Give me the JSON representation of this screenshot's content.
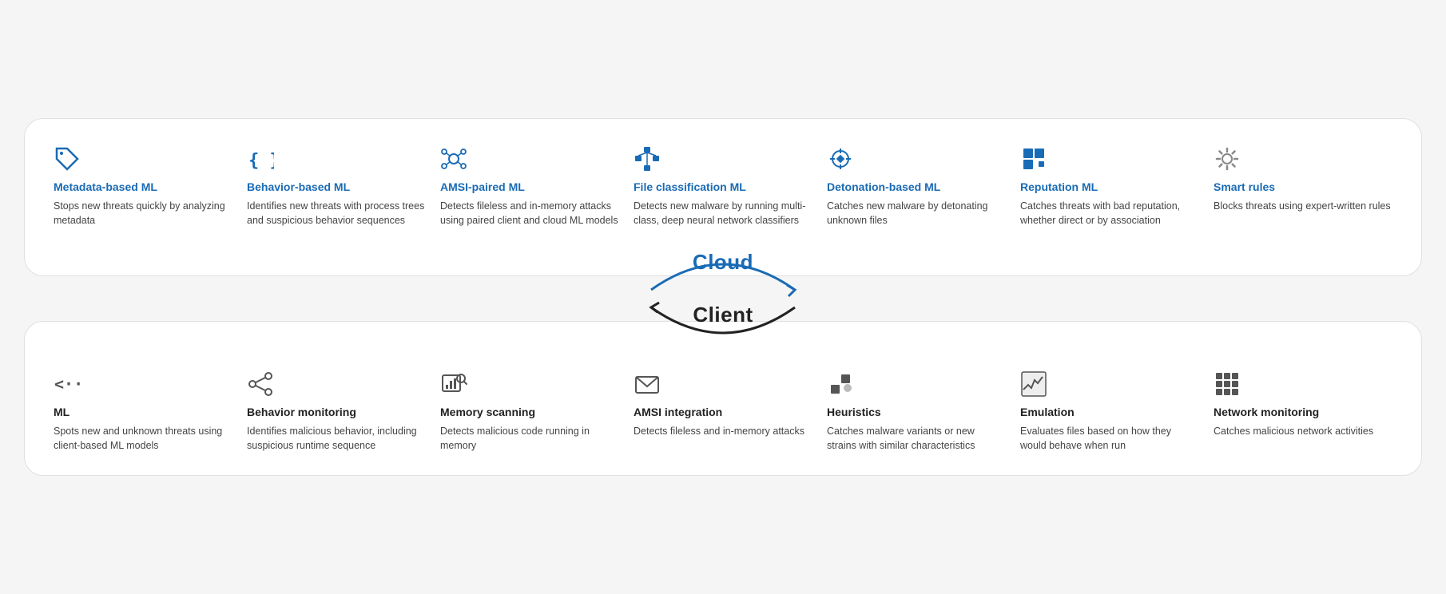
{
  "cloud": {
    "label": "Cloud",
    "items": [
      {
        "id": "metadata-ml",
        "title": "Metadata-based ML",
        "desc": "Stops new threats quickly by analyzing metadata",
        "icon": "tag"
      },
      {
        "id": "behavior-ml",
        "title": "Behavior-based ML",
        "desc": "Identifies new threats with process trees and suspicious behavior sequences",
        "icon": "braces"
      },
      {
        "id": "amsi-ml",
        "title": "AMSI-paired ML",
        "desc": "Detects fileless and in-memory attacks using paired client and cloud ML models",
        "icon": "network"
      },
      {
        "id": "file-class-ml",
        "title": "File classification ML",
        "desc": "Detects new malware by running multi-class, deep neural network classifiers",
        "icon": "hierarchy"
      },
      {
        "id": "detonation-ml",
        "title": "Detonation-based ML",
        "desc": "Catches new malware by detonating unknown files",
        "icon": "crosshair"
      },
      {
        "id": "reputation-ml",
        "title": "Reputation ML",
        "desc": "Catches threats with bad reputation, whether direct or by association",
        "icon": "squares"
      },
      {
        "id": "smart-rules",
        "title": "Smart rules",
        "desc": "Blocks threats using expert-written rules",
        "icon": "gear"
      }
    ]
  },
  "client": {
    "label": "Client",
    "items": [
      {
        "id": "ml-client",
        "title": "ML",
        "desc": "Spots new and unknown threats using client-based ML models",
        "icon": "ml-client"
      },
      {
        "id": "behavior-monitoring",
        "title": "Behavior monitoring",
        "desc": "Identifies malicious behavior, including suspicious runtime sequence",
        "icon": "share"
      },
      {
        "id": "memory-scanning",
        "title": "Memory scanning",
        "desc": "Detects malicious code running in memory",
        "icon": "chart-search"
      },
      {
        "id": "amsi-integration",
        "title": "AMSI integration",
        "desc": "Detects fileless and in-memory attacks",
        "icon": "envelope"
      },
      {
        "id": "heuristics",
        "title": "Heuristics",
        "desc": "Catches malware variants or new strains with similar characteristics",
        "icon": "dots"
      },
      {
        "id": "emulation",
        "title": "Emulation",
        "desc": "Evaluates files based on how they would behave when run",
        "icon": "chart-wave"
      },
      {
        "id": "network-monitoring",
        "title": "Network monitoring",
        "desc": "Catches malicious network activities",
        "icon": "grid"
      }
    ]
  }
}
